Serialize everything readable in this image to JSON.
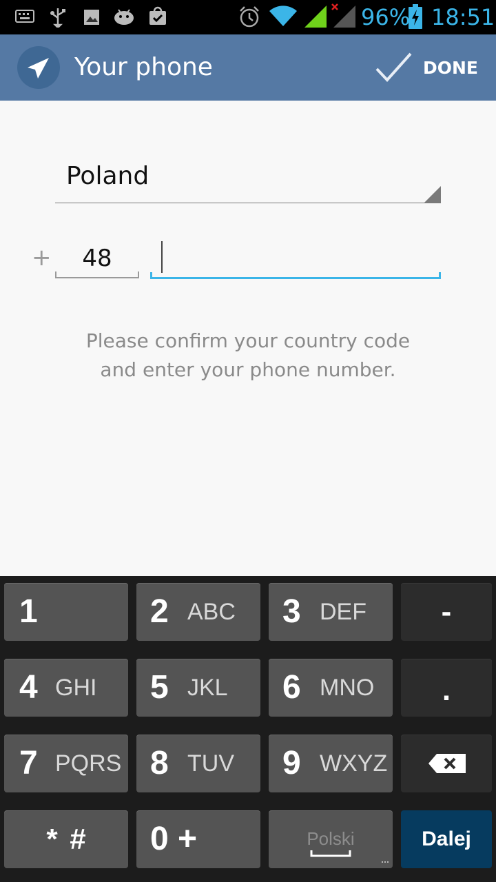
{
  "status_bar": {
    "battery": "96%",
    "time": "18:51",
    "icons": [
      "keyboard-icon",
      "usb-icon",
      "gallery-icon",
      "android-debug-icon",
      "store-icon",
      "alarm-icon",
      "wifi-icon",
      "signal-icon",
      "signal-no-data-icon",
      "battery-charging-icon"
    ]
  },
  "action_bar": {
    "title": "Your phone",
    "done_label": "DONE",
    "icons": [
      "telegram-logo-icon",
      "checkmark-icon"
    ]
  },
  "form": {
    "country": "Poland",
    "plus_sign": "+",
    "country_code": "48",
    "phone_value": "",
    "hint_line1": "Please confirm your country code",
    "hint_line2": "and enter your phone number."
  },
  "keyboard": {
    "rows": [
      [
        {
          "num": "1",
          "letters": ""
        },
        {
          "num": "2",
          "letters": "ABC"
        },
        {
          "num": "3",
          "letters": "DEF"
        },
        {
          "label": "-"
        }
      ],
      [
        {
          "num": "4",
          "letters": "GHI"
        },
        {
          "num": "5",
          "letters": "JKL"
        },
        {
          "num": "6",
          "letters": "MNO"
        },
        {
          "label": "."
        }
      ],
      [
        {
          "num": "7",
          "letters": "PQRS"
        },
        {
          "num": "8",
          "letters": "TUV"
        },
        {
          "num": "9",
          "letters": "WXYZ"
        },
        {
          "label": "backspace-icon"
        }
      ],
      [
        {
          "label": "* #"
        },
        {
          "label": "0 +"
        },
        {
          "label": "Polski"
        },
        {
          "label": "Dalej"
        }
      ]
    ],
    "enter_color": "#063b5f"
  },
  "colors": {
    "action_bar": "#5579a4",
    "accent": "#3bb5e8"
  }
}
